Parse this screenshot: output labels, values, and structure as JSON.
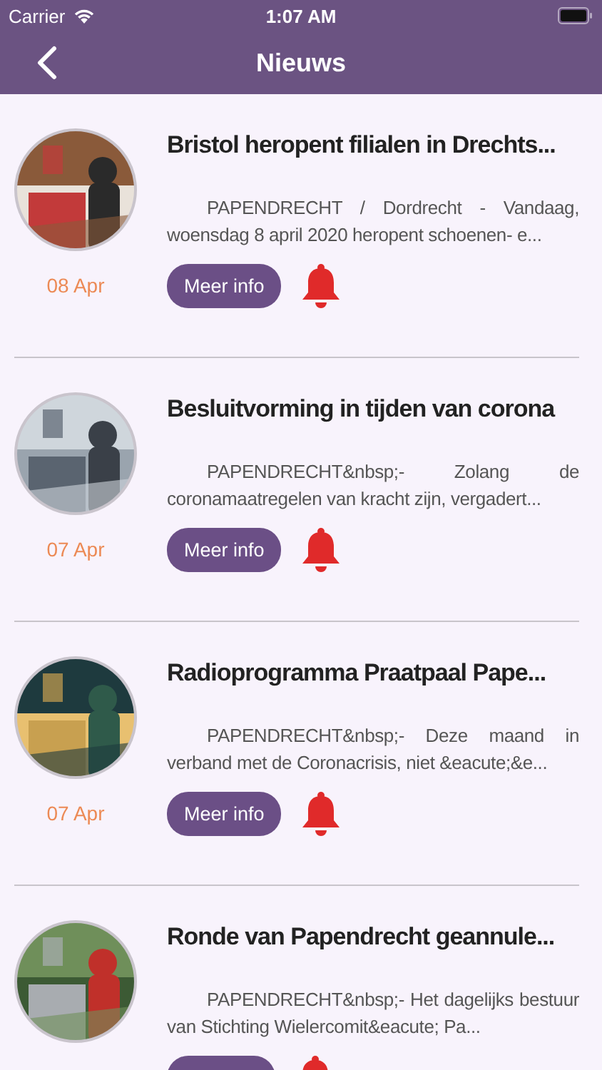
{
  "status_bar": {
    "carrier": "Carrier",
    "time": "1:07 AM"
  },
  "nav_bar": {
    "title": "Nieuws"
  },
  "news": [
    {
      "title": "Bristol heropent filialen in Drechts...",
      "summary": "PAPENDRECHT / Dordrecht - Vandaag, woensdag 8 april 2020 heropent schoenen- e...",
      "date": "08 Apr",
      "button": "Meer info"
    },
    {
      "title": "Besluitvorming in tijden van corona",
      "summary": "PAPENDRECHT&nbsp;- Zolang de coronamaatregelen van kracht zijn, vergadert...",
      "date": "07 Apr",
      "button": "Meer info"
    },
    {
      "title": "Radioprogramma Praatpaal Pape...",
      "summary": "PAPENDRECHT&nbsp;- Deze maand in verband met de Coronacrisis, niet &eacute;&e...",
      "date": "07 Apr",
      "button": "Meer info"
    },
    {
      "title": "Ronde van Papendrecht geannule...",
      "summary": "PAPENDRECHT&nbsp;- Het dagelijks bestuur van Stichting Wielercomit&eacute; Pa..."
    }
  ]
}
